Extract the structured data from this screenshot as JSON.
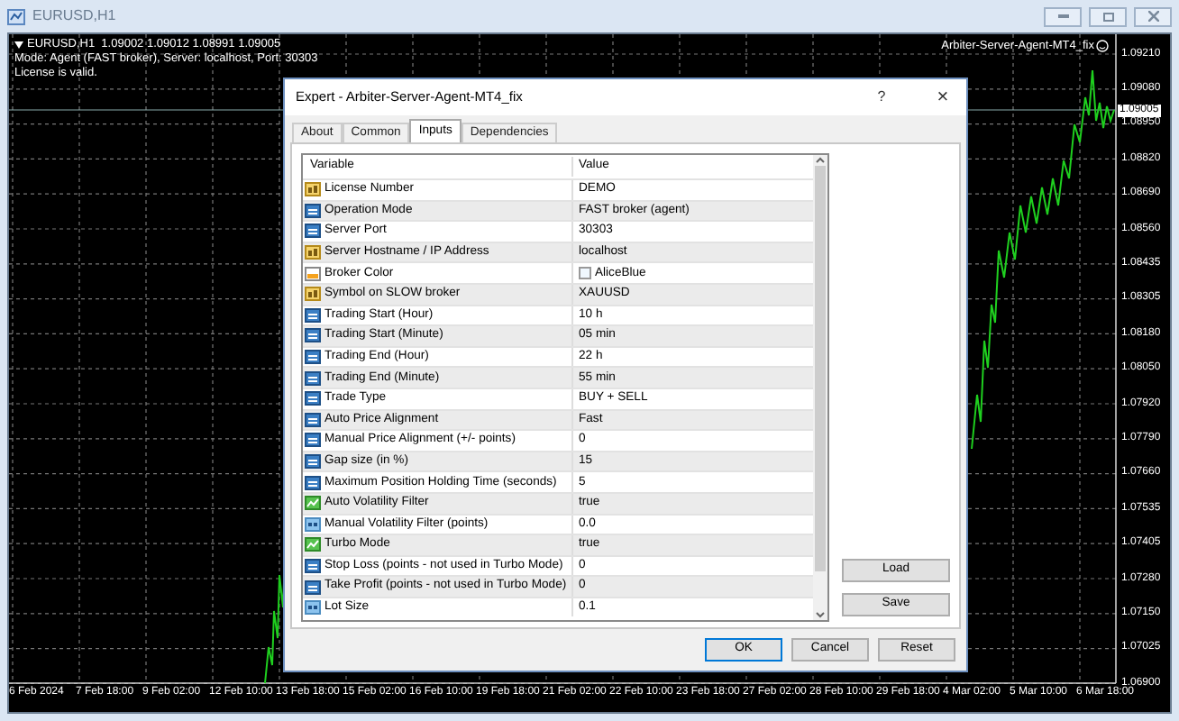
{
  "window": {
    "title": "EURUSD,H1"
  },
  "chart": {
    "symbol_line": "EURUSD,H1  1.09002 1.09012 1.08991 1.09005",
    "info_lines": [
      "Mode: Agent (FAST broker), Server: localhost, Port: 30303",
      "License is valid."
    ],
    "expert_label": "Arbiter-Server-Agent-MT4_fix",
    "current_price": "1.09005",
    "price_labels": [
      "1.09210",
      "1.09080",
      "1.08950",
      "1.08820",
      "1.08690",
      "1.08560",
      "1.08435",
      "1.08305",
      "1.08180",
      "1.08050",
      "1.07920",
      "1.07790",
      "1.07660",
      "1.07535",
      "1.07405",
      "1.07280",
      "1.07150",
      "1.07025",
      "1.06900"
    ],
    "time_labels": [
      "6 Feb 2024",
      "7 Feb 18:00",
      "9 Feb 02:00",
      "12 Feb 10:00",
      "13 Feb 18:00",
      "15 Feb 02:00",
      "16 Feb 10:00",
      "19 Feb 18:00",
      "21 Feb 02:00",
      "22 Feb 10:00",
      "23 Feb 18:00",
      "27 Feb 02:00",
      "28 Feb 10:00",
      "29 Feb 18:00",
      "4 Mar 02:00",
      "5 Mar 10:00",
      "6 Mar 18:00"
    ]
  },
  "dialog": {
    "title": "Expert - Arbiter-Server-Agent-MT4_fix",
    "help": "?",
    "close": "×",
    "tabs": [
      {
        "label": "About",
        "selected": false
      },
      {
        "label": "Common",
        "selected": false
      },
      {
        "label": "Inputs",
        "selected": true
      },
      {
        "label": "Dependencies",
        "selected": false
      }
    ],
    "table": {
      "columns": [
        "Variable",
        "Value"
      ],
      "rows": [
        {
          "kind": "string",
          "variable": "License Number",
          "value": "DEMO"
        },
        {
          "kind": "int",
          "variable": "Operation Mode",
          "value": "FAST broker (agent)"
        },
        {
          "kind": "int",
          "variable": "Server Port",
          "value": "30303"
        },
        {
          "kind": "string",
          "variable": "Server Hostname / IP Address",
          "value": "localhost"
        },
        {
          "kind": "color",
          "variable": "Broker Color",
          "value": "AliceBlue"
        },
        {
          "kind": "string",
          "variable": "Symbol on SLOW broker",
          "value": "XAUUSD"
        },
        {
          "kind": "int",
          "variable": "Trading Start (Hour)",
          "value": "10 h"
        },
        {
          "kind": "int",
          "variable": "Trading Start (Minute)",
          "value": "05 min"
        },
        {
          "kind": "int",
          "variable": "Trading End (Hour)",
          "value": "22 h"
        },
        {
          "kind": "int",
          "variable": "Trading End (Minute)",
          "value": "55 min"
        },
        {
          "kind": "int",
          "variable": "Trade Type",
          "value": "BUY + SELL"
        },
        {
          "kind": "int",
          "variable": "Auto Price Alignment",
          "value": "Fast"
        },
        {
          "kind": "int",
          "variable": "Manual Price Alignment (+/- points)",
          "value": "0"
        },
        {
          "kind": "int",
          "variable": "Gap size (in %)",
          "value": "15"
        },
        {
          "kind": "int",
          "variable": "Maximum Position Holding Time (seconds)",
          "value": "5"
        },
        {
          "kind": "bool",
          "variable": "Auto Volatility Filter",
          "value": "true"
        },
        {
          "kind": "double",
          "variable": "Manual Volatility Filter (points)",
          "value": "0.0"
        },
        {
          "kind": "bool",
          "variable": "Turbo Mode",
          "value": "true"
        },
        {
          "kind": "int",
          "variable": "Stop Loss (points - not used in Turbo Mode)",
          "value": "0"
        },
        {
          "kind": "int",
          "variable": "Take Profit (points - not used in Turbo Mode)",
          "value": "0"
        },
        {
          "kind": "double",
          "variable": "Lot Size",
          "value": "0.1"
        }
      ]
    },
    "side_buttons": [
      "Load",
      "Save"
    ],
    "buttons": [
      {
        "label": "OK",
        "default": true
      },
      {
        "label": "Cancel",
        "default": false
      },
      {
        "label": "Reset",
        "default": false
      }
    ]
  }
}
